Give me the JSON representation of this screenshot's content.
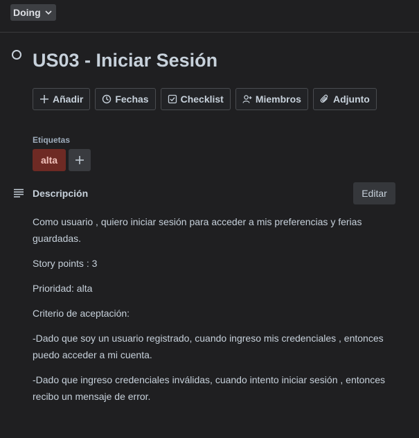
{
  "header": {
    "status_label": "Doing"
  },
  "card": {
    "title": "US03 - Iniciar Sesión"
  },
  "actions": [
    {
      "label": "Añadir",
      "icon": "plus-icon"
    },
    {
      "label": "Fechas",
      "icon": "clock-icon"
    },
    {
      "label": "Checklist",
      "icon": "checklist-icon"
    },
    {
      "label": "Miembros",
      "icon": "add-member-icon"
    },
    {
      "label": "Adjunto",
      "icon": "paperclip-icon"
    }
  ],
  "labels": {
    "heading": "Etiquetas",
    "items": [
      {
        "text": "alta",
        "color": "#6e2a24"
      }
    ]
  },
  "description": {
    "heading": "Descripción",
    "edit_label": "Editar",
    "paragraphs": [
      "Como usuario , quiero iniciar sesión para acceder a mis preferencias y ferias guardadas.",
      "Story points : 3",
      "Prioridad: alta",
      "Criterio de aceptación:",
      "-Dado que soy un usuario registrado, cuando ingreso mis credenciales , entonces puedo acceder a mi cuenta.",
      "-Dado que ingreso credenciales inválidas, cuando intento iniciar sesión , entonces recibo un mensaje de error."
    ]
  },
  "colors": {
    "background": "#1f1f21",
    "label_red": "#6e2a24",
    "text": "#c7d1db"
  }
}
